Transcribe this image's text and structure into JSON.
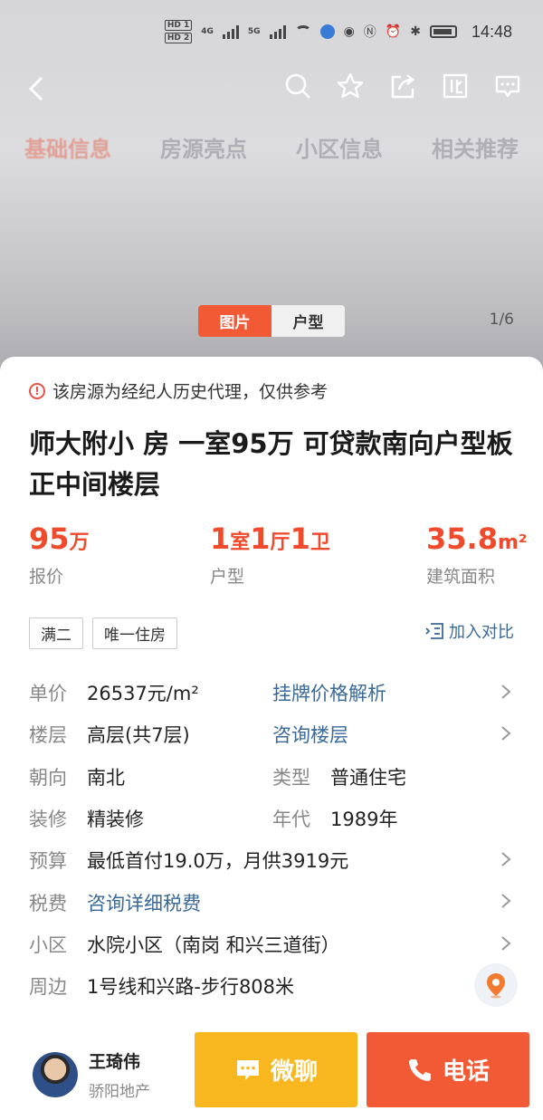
{
  "status_bar": {
    "time": "14:48",
    "sim_chip_1": "HD 1",
    "sim_chip_2": "HD 2",
    "net_1": "4G",
    "net_2": "5G"
  },
  "nav": {
    "back_icon": "chevron-left-icon",
    "action_icons": [
      "search-icon",
      "star-icon",
      "share-icon",
      "compare-icon",
      "message-icon"
    ]
  },
  "section_tabs": [
    "基础信息",
    "房源亮点",
    "小区信息",
    "相关推荐"
  ],
  "media": {
    "tab_photos": "图片",
    "tab_floorplan": "户型",
    "counter": "1/6"
  },
  "notice": "该房源为经纪人历史代理，仅供参考",
  "title": "师大附小  房 一室95万 可贷款南向户型板正中间楼层",
  "stats": {
    "price_value": "95",
    "price_unit": "万",
    "price_label": "报价",
    "layout_rooms": "1",
    "layout_rooms_unit": "室",
    "layout_halls": "1",
    "layout_halls_unit": "厅",
    "layout_baths": "1",
    "layout_baths_unit": "卫",
    "layout_label": "户型",
    "area_value": "35.8",
    "area_unit": "m²",
    "area_label": "建筑面积"
  },
  "tags": [
    "满二",
    "唯一住房"
  ],
  "compare_label": "加入对比",
  "info": {
    "unit_price_key": "单价",
    "unit_price_value": "26537元/m²",
    "price_analysis_link": "挂牌价格解析",
    "floor_key": "楼层",
    "floor_value": "高层(共7层)",
    "floor_consult_link": "咨询楼层",
    "orientation_key": "朝向",
    "orientation_value": "南北",
    "type_key": "类型",
    "type_value": "普通住宅",
    "decoration_key": "装修",
    "decoration_value": "精装修",
    "year_key": "年代",
    "year_value": "1989年",
    "budget_key": "预算",
    "budget_value": "最低首付19.0万，月供3919元",
    "tax_key": "税费",
    "tax_link": "咨询详细税费",
    "community_key": "小区",
    "community_value": "水院小区（南岗 和兴三道街）",
    "nearby_key": "周边",
    "nearby_value": "1号线和兴路-步行808米"
  },
  "agent": {
    "name": "王琦伟",
    "company": "骄阳地产"
  },
  "buttons": {
    "chat_label": "微聊",
    "call_label": "电话"
  },
  "colors": {
    "accent_red": "#f25a35",
    "price_red": "#ee4a2b",
    "chat_yellow": "#f8b71f",
    "link_blue": "#3a6a9a"
  }
}
